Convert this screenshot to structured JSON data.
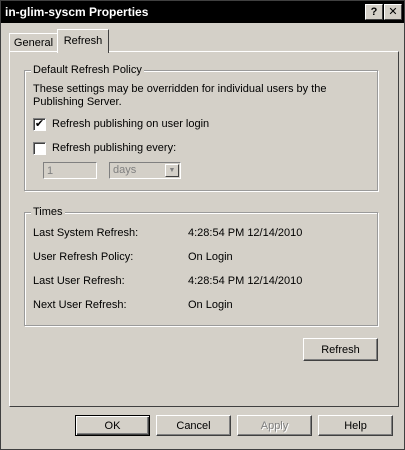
{
  "window": {
    "title": "in-glim-syscm Properties",
    "help_glyph": "?",
    "close_glyph": "✕"
  },
  "tabs": [
    {
      "label": "General",
      "active": false
    },
    {
      "label": "Refresh",
      "active": true
    }
  ],
  "policy": {
    "legend": "Default Refresh Policy",
    "description": "These settings may be overridden for individual users by the Publishing Server.",
    "refresh_on_login": {
      "label": "Refresh publishing on user login",
      "checked": true,
      "mark": "✔"
    },
    "refresh_every": {
      "label": "Refresh publishing every:",
      "checked": false,
      "mark": ""
    },
    "interval_value": "1",
    "interval_unit": "days",
    "dropdown_arrow": "▼"
  },
  "times": {
    "legend": "Times",
    "rows": [
      {
        "label": "Last System Refresh:",
        "value": "4:28:54 PM 12/14/2010"
      },
      {
        "label": "User Refresh Policy:",
        "value": "On Login"
      },
      {
        "label": "Last User Refresh:",
        "value": "4:28:54 PM 12/14/2010"
      },
      {
        "label": "Next User Refresh:",
        "value": "On Login"
      }
    ]
  },
  "refresh_button": "Refresh",
  "footer": {
    "ok": "OK",
    "cancel": "Cancel",
    "apply": "Apply",
    "help": "Help"
  }
}
